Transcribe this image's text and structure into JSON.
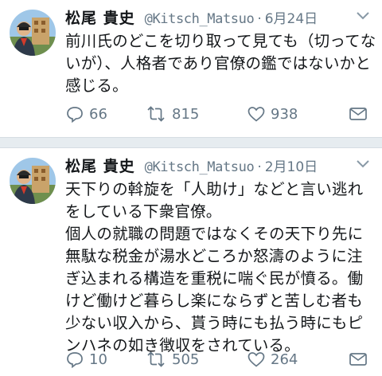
{
  "tweets": [
    {
      "user_name": "松尾 貴史",
      "handle": "@Kitsch_Matsuo",
      "separator": "·",
      "date": "6月24日",
      "text": "前川氏のどこを切り取って見ても（切ってないが）、人格者であり官僚の鑑ではないかと感じる。",
      "replies": "66",
      "retweets": "815",
      "likes": "938"
    },
    {
      "user_name": "松尾 貴史",
      "handle": "@Kitsch_Matsuo",
      "separator": "·",
      "date": "2月10日",
      "text": "天下りの斡旋を「人助け」などと言い逃れをしている下衆官僚。\n個人の就職の問題ではなくその天下り先に無駄な税金が湯水どころか怒濤のように注ぎ込まれる構造を重税に喘ぐ民が憤る。働けど働けど暮らし楽にならずと苦しむ者も少ない収入から、貰う時にも払う時にもピンハネの如き徴収をされている。",
      "replies": "10",
      "retweets": "505",
      "likes": "264"
    }
  ],
  "colors": {
    "text": "#14171a",
    "muted": "#657786",
    "divider": "#e6ecf0"
  }
}
